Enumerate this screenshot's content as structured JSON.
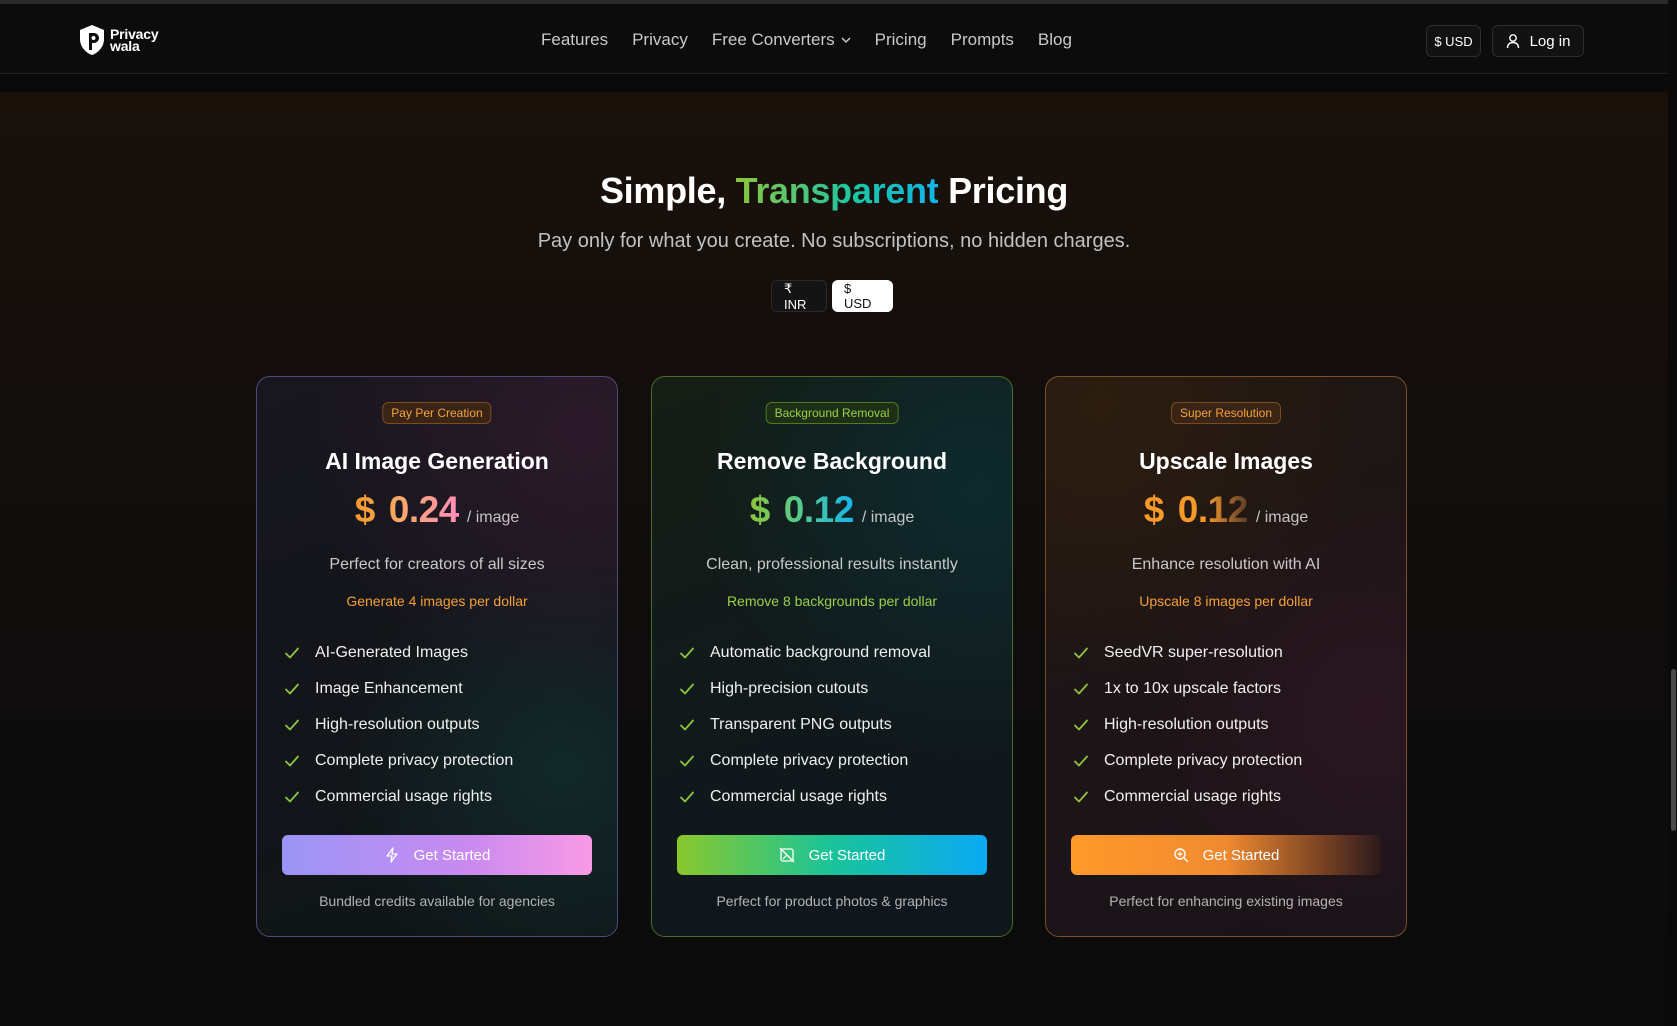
{
  "nav": {
    "logo_line1": "Privacy",
    "logo_line2": "wala",
    "links": [
      "Features",
      "Privacy",
      "Free Converters",
      "Pricing",
      "Prompts",
      "Blog"
    ],
    "currency_button": "$ USD",
    "login_label": "Log in"
  },
  "hero": {
    "title_part1": "Simple, ",
    "title_highlight": "Transparent",
    "title_part2": " Pricing",
    "subtitle": "Pay only for what you create. No subscriptions, no hidden charges.",
    "currency_toggle": {
      "inr": "₹ INR",
      "usd": "$ USD",
      "selected": "$ USD"
    }
  },
  "cards": [
    {
      "badge": "Pay Per Creation",
      "title": "AI Image Generation",
      "currency": "$",
      "price": "0.24",
      "unit": "/ image",
      "description": "Perfect for creators of all sizes",
      "per_dollar": "Generate 4 images per dollar",
      "features": [
        "AI-Generated Images",
        "Image Enhancement",
        "High-resolution outputs",
        "Complete privacy protection",
        "Commercial usage rights"
      ],
      "cta": "Get Started",
      "cta_icon": "lightning-icon",
      "footnote": "Bundled credits available for agencies"
    },
    {
      "badge": "Background Removal",
      "title": "Remove Background",
      "currency": "$",
      "price": "0.12",
      "unit": "/ image",
      "description": "Clean, professional results instantly",
      "per_dollar": "Remove 8 backgrounds per dollar",
      "features": [
        "Automatic background removal",
        "High-precision cutouts",
        "Transparent PNG outputs",
        "Complete privacy protection",
        "Commercial usage rights"
      ],
      "cta": "Get Started",
      "cta_icon": "image-off-icon",
      "footnote": "Perfect for product photos & graphics"
    },
    {
      "badge": "Super Resolution",
      "title": "Upscale Images",
      "currency": "$",
      "price": "0.12",
      "unit": "/ image",
      "description": "Enhance resolution with AI",
      "per_dollar": "Upscale 8 images per dollar",
      "features": [
        "SeedVR super-resolution",
        "1x to 10x upscale factors",
        "High-resolution outputs",
        "Complete privacy protection",
        "Commercial usage rights"
      ],
      "cta": "Get Started",
      "cta_icon": "zoom-in-icon",
      "footnote": "Perfect for enhancing existing images"
    }
  ],
  "colors": {
    "check": "#8cc63f",
    "accent_orange": "#f5a035",
    "accent_green": "#9ad04a"
  }
}
